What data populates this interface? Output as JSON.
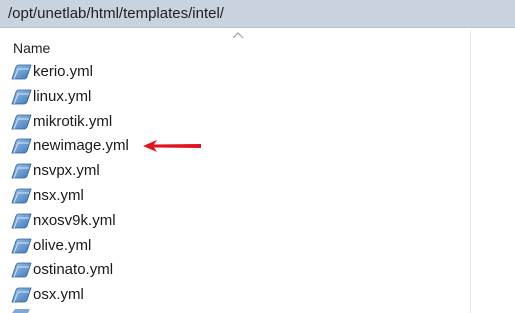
{
  "path_bar": {
    "path": "/opt/unetlab/html/templates/intel/"
  },
  "list_header": {
    "name_label": "Name",
    "sort_icon": "chevron-up-icon"
  },
  "files": [
    {
      "name": "kerio.yml",
      "icon": "yml-file-icon"
    },
    {
      "name": "linux.yml",
      "icon": "yml-file-icon"
    },
    {
      "name": "mikrotik.yml",
      "icon": "yml-file-icon"
    },
    {
      "name": "newimage.yml",
      "icon": "yml-file-icon"
    },
    {
      "name": "nsvpx.yml",
      "icon": "yml-file-icon"
    },
    {
      "name": "nsx.yml",
      "icon": "yml-file-icon"
    },
    {
      "name": "nxosv9k.yml",
      "icon": "yml-file-icon"
    },
    {
      "name": "olive.yml",
      "icon": "yml-file-icon"
    },
    {
      "name": "ostinato.yml",
      "icon": "yml-file-icon"
    },
    {
      "name": "osx.yml",
      "icon": "yml-file-icon"
    }
  ],
  "annotation": {
    "icon": "red-arrow-icon",
    "color": "#e0141e"
  },
  "colors": {
    "path_bar_bg": "#c9d3df",
    "file_icon_blue": "#5b8fc9"
  }
}
